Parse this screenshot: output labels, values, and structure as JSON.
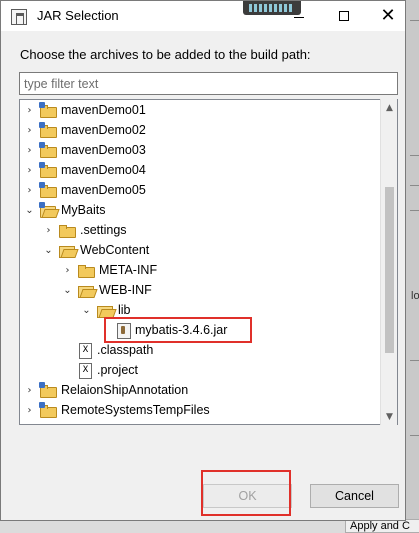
{
  "dialog": {
    "title": "JAR Selection",
    "prompt": "Choose the archives to be added to the build path:",
    "filter": {
      "value": "",
      "placeholder": "type filter text"
    },
    "ok_label": "OK",
    "cancel_label": "Cancel"
  },
  "tree": {
    "rows": [
      {
        "label": "mavenDemo01",
        "twisty": "›",
        "icon": "project-folder-icon"
      },
      {
        "label": "mavenDemo02",
        "twisty": "›",
        "icon": "project-folder-icon"
      },
      {
        "label": "mavenDemo03",
        "twisty": "›",
        "icon": "project-folder-icon"
      },
      {
        "label": "mavenDemo04",
        "twisty": "›",
        "icon": "project-folder-icon"
      },
      {
        "label": "mavenDemo05",
        "twisty": "›",
        "icon": "project-folder-icon"
      },
      {
        "label": "MyBaits",
        "twisty": "⌄",
        "icon": "project-folder-open-icon"
      },
      {
        "label": ".settings",
        "twisty": "›",
        "icon": "folder-icon"
      },
      {
        "label": "WebContent",
        "twisty": "⌄",
        "icon": "folder-open-icon"
      },
      {
        "label": "META-INF",
        "twisty": "›",
        "icon": "folder-icon"
      },
      {
        "label": "WEB-INF",
        "twisty": "⌄",
        "icon": "folder-open-icon"
      },
      {
        "label": "lib",
        "twisty": "⌄",
        "icon": "folder-open-icon"
      },
      {
        "label": "mybatis-3.4.6.jar",
        "twisty": "",
        "icon": "jar-file-icon"
      },
      {
        "label": ".classpath",
        "twisty": "",
        "icon": "xml-file-icon"
      },
      {
        "label": ".project",
        "twisty": "",
        "icon": "xml-file-icon"
      },
      {
        "label": "RelaionShipAnnotation",
        "twisty": "›",
        "icon": "project-folder-icon"
      },
      {
        "label": "RemoteSystemsTempFiles",
        "twisty": "›",
        "icon": "project-folder-icon"
      }
    ]
  },
  "background": {
    "apply_label": "Apply and C",
    "side_fragment": "lo"
  },
  "colors": {
    "highlight": "#e0302a",
    "dialog_bg": "#f0f0f0",
    "titlebar_bg": "#ffffff"
  }
}
